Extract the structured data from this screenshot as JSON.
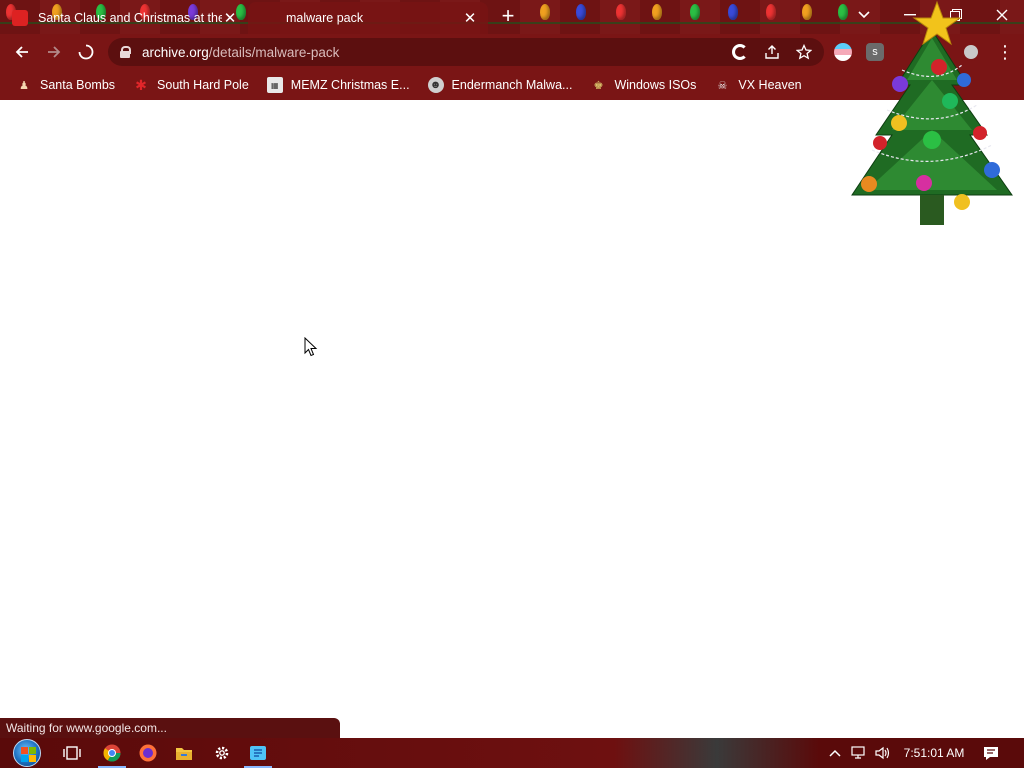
{
  "tabs": [
    {
      "title": "Santa Claus and Christmas at the",
      "favicon": "christmas-favicon",
      "active": false
    },
    {
      "title": "malware pack",
      "favicon": "archive-favicon",
      "active": true
    }
  ],
  "window_controls": {
    "tab_search_icon": "chevron-down-icon",
    "minimize": "minimize-icon",
    "restore": "restore-icon",
    "close": "close-icon"
  },
  "toolbar": {
    "url_host": "archive.org",
    "url_path": "/details/malware-pack",
    "reload_state": "loading"
  },
  "bookmarks": [
    {
      "label": "Santa Bombs",
      "icon": "santa-icon"
    },
    {
      "label": "South Hard Pole",
      "icon": "snowflake-icon"
    },
    {
      "label": "MEMZ Christmas E...",
      "icon": "memz-icon"
    },
    {
      "label": "Endermanch Malwa...",
      "icon": "endermanch-icon"
    },
    {
      "label": "Windows ISOs",
      "icon": "windows-isos-icon"
    },
    {
      "label": "VX Heaven",
      "icon": "vx-heaven-icon"
    }
  ],
  "status_bar": {
    "text": "Waiting for www.google.com..."
  },
  "taskbar": {
    "clock": "7:51:01 AM",
    "pinned": [
      "task-view-icon",
      "chrome-icon",
      "firefox-icon",
      "file-explorer-icon",
      "settings-icon",
      "notepad-icon"
    ]
  },
  "colors": {
    "theme": "#7a1515",
    "tab_strip": "#6e1313",
    "page": "#ffffff"
  }
}
